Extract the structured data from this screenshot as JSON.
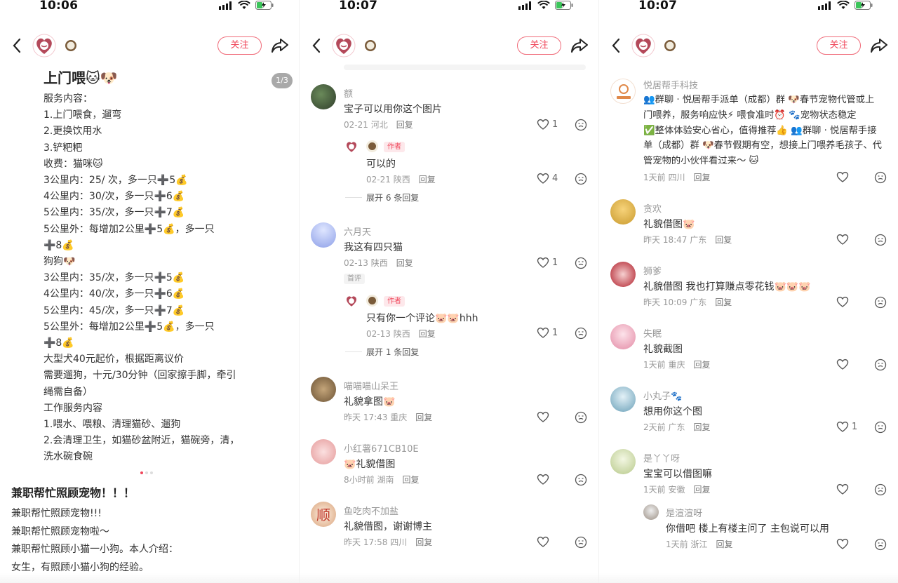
{
  "status": [
    {
      "time": "10:06"
    },
    {
      "time": "10:07"
    },
    {
      "time": "10:07"
    }
  ],
  "header": {
    "follow_label": "关注"
  },
  "note": {
    "title": "上门喂🐱🐶",
    "pager": "1/3",
    "lines": [
      "服务内容：",
      "1.上门喂食，遛弯",
      "2.更换饮用水",
      "3.铲粑粑",
      "收费：猫咪🐱",
      "3公里内：25/ 次，多一只➕5💰",
      "4公里内：30/次，多一只➕6💰",
      "5公里内：35/次，多一只➕7💰",
      "5公里外：每增加2公里➕5💰，多一只",
      "➕8💰",
      "          狗狗🐶",
      "3公里内：35/次，多一只➕5💰",
      "4公里内：40/次，多一只➕6💰",
      "5公里内：45/次，多一只➕7💰",
      "5公里外：每增加2公里➕5💰，多一只",
      "➕8💰",
      "大型犬40元起价，根据距离议价",
      "需要遛狗，十元/30分钟（回家擦手脚，牵引",
      "绳需自备）",
      "工作服务内容",
      "1.喂水、喂粮、清理猫砂、遛狗",
      "2.会清理卫生，如猫砂盆附近，猫碗旁，清，",
      "洗水碗食碗"
    ],
    "post_title": "兼职帮忙照顾宠物！！！",
    "post_body": [
      "兼职帮忙照顾宠物!!!",
      "兼职帮忙照顾宠物啦～",
      "兼职帮忙照顾小猫一小狗。本人介绍：",
      "女生，有照顾小猫小狗的经验。"
    ]
  },
  "panel2": {
    "comments": [
      {
        "name": "额",
        "text": "宝子可以用你这个图片",
        "date": "02-21",
        "region": "河北",
        "reply": "回复",
        "likes": "1",
        "sub": {
          "badge": "作者",
          "text": "可以的",
          "date": "02-21",
          "region": "陕西",
          "reply": "回复",
          "likes": "4"
        },
        "expand": "展开 6 条回复"
      },
      {
        "name": "六月天",
        "text": "我这有四只猫",
        "date": "02-13",
        "region": "陕西",
        "reply": "回复",
        "likes": "1",
        "tag": "首评",
        "sub": {
          "badge": "作者",
          "text": "只有你一个评论🐷🐷hhh",
          "date": "02-13",
          "region": "陕西",
          "reply": "回复",
          "likes": "1"
        },
        "expand": "展开 1 条回复"
      },
      {
        "name": "喵喵喵山呆王",
        "text": "礼貌拿图🐷",
        "date": "昨天 17:43",
        "region": "重庆",
        "reply": "回复",
        "likes": ""
      },
      {
        "name": "小红薯671CB10E",
        "text": "🐷礼貌借图",
        "date": "8小时前",
        "region": "湖南",
        "reply": "回复",
        "likes": ""
      },
      {
        "name": "鱼吃肉不加盐",
        "text": "礼貌借图，谢谢博主",
        "date": "昨天 17:58",
        "region": "四川",
        "reply": "回复",
        "likes": ""
      }
    ]
  },
  "panel3": {
    "top": {
      "name": "悦居帮手科技",
      "lines": [
        "👥群聊 · 悦居帮手派单（成都）群 🐶春节宠物代管或上",
        "门喂养，服务响应快⚡ 喂食准时⏰ 🐾宠物状态稳定",
        "✅整体体验安心省心，值得推荐👍 👥群聊 · 悦居帮手接",
        "单（成都）群 🐶春节假期有空，想接上门喂养毛孩子、代",
        "管宠物的小伙伴看过来～ 🐱"
      ],
      "date": "1天前",
      "region": "四川",
      "reply": "回复"
    },
    "comments": [
      {
        "name": "贪欢",
        "text": "礼貌借图🐷",
        "date": "昨天 18:47",
        "region": "广东",
        "reply": "回复",
        "likes": ""
      },
      {
        "name": "狮爹",
        "text": "礼貌借图 我也打算赚点零花钱🐷🐷🐷",
        "date": "昨天 10:09",
        "region": "广东",
        "reply": "回复",
        "likes": ""
      },
      {
        "name": "失眠",
        "text": "礼貌截图",
        "date": "1天前",
        "region": "重庆",
        "reply": "回复",
        "likes": ""
      },
      {
        "name": "小丸子🐾",
        "text": "想用你这个图",
        "date": "2天前",
        "region": "广东",
        "reply": "回复",
        "likes": "1"
      },
      {
        "name": "是丫丫呀",
        "text": "宝宝可以借图嘛",
        "date": "1天前",
        "region": "安徽",
        "reply": "回复",
        "likes": "",
        "sub": {
          "name": "是渲渲呀",
          "text": "你借吧 楼上有楼主问了 主包说可以用",
          "date": "1天前",
          "region": "浙江",
          "reply": "回复",
          "likes": ""
        }
      }
    ]
  },
  "colors": {
    "accent": "#f0485c",
    "meta": "#999999",
    "text": "#333333"
  },
  "icons": [
    "back-icon",
    "share-icon",
    "heart-icon",
    "dislike-icon",
    "signal-icon",
    "wifi-icon",
    "battery-icon"
  ]
}
